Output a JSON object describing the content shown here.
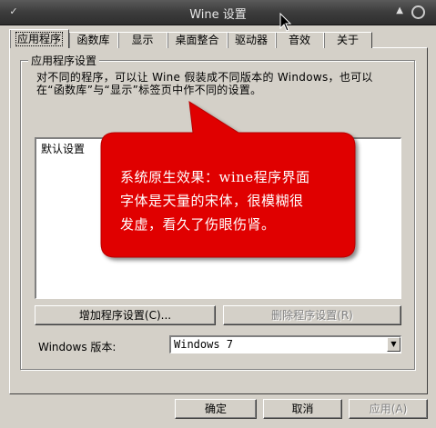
{
  "window": {
    "title": "Wine 设置"
  },
  "tabs": [
    "应用程序",
    "函数库",
    "显示",
    "桌面整合",
    "驱动器",
    "音效",
    "关于"
  ],
  "group": {
    "label": "应用程序设置",
    "description_line1": "对不同的程序，可以让 Wine 假装成不同版本的 Windows，也可以",
    "description_line2": "在“函数库”与“显示”标签页中作不同的设置。"
  },
  "list": {
    "items": [
      "默认设置"
    ]
  },
  "buttons": {
    "add": "增加程序设置(C)...",
    "remove": "删除程序设置(R)",
    "ok": "确定",
    "cancel": "取消",
    "apply": "应用(A)"
  },
  "version": {
    "label": "Windows 版本:",
    "value": "Windows 7"
  },
  "annotation": {
    "line1": "系统原生效果：wine程序界面",
    "line2": "字体是天量的宋体，很模糊很",
    "line3": "发虚，看久了伤眼伤肾。"
  },
  "colors": {
    "annotation_bg": "#e00000",
    "face": "#d4d0c8"
  }
}
